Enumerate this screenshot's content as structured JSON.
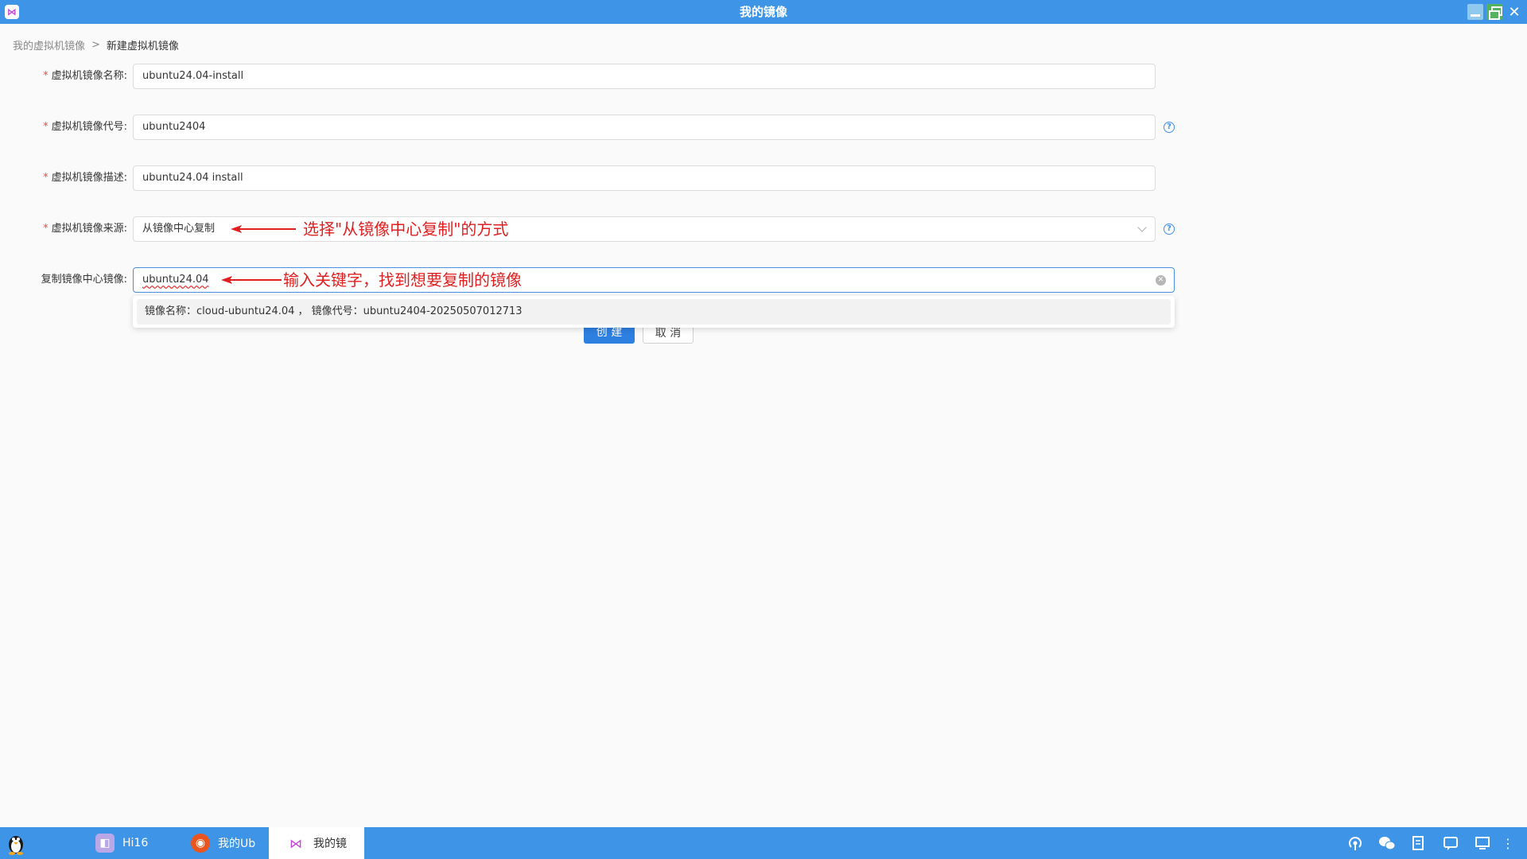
{
  "window": {
    "title": "我的镜像",
    "app_icon_glyph": "⋈",
    "min_label": "",
    "max_label": "",
    "close_label": "✕"
  },
  "breadcrumb": {
    "parent": "我的虚拟机镜像",
    "separator": ">",
    "current": "新建虚拟机镜像"
  },
  "form": {
    "name_label": "虚拟机镜像名称:",
    "name_value": "ubuntu24.04-install",
    "code_label": "虚拟机镜像代号:",
    "code_value": "ubuntu2404",
    "desc_label": "虚拟机镜像描述:",
    "desc_value": "ubuntu24.04 install",
    "source_label": "虚拟机镜像来源:",
    "source_value": "从镜像中心复制",
    "copy_label": "复制镜像中心镜像:",
    "copy_value": "ubuntu24.04",
    "required_mark": "*",
    "help_glyph": "?"
  },
  "annotations": {
    "source_note": "选择\"从镜像中心复制\"的方式",
    "copy_note": "输入关键字，找到想要复制的镜像"
  },
  "dropdown": {
    "item": "镜像名称：cloud-ubuntu24.04 ，  镜像代号：ubuntu2404-20250507012713"
  },
  "buttons": {
    "create": "创 建",
    "cancel": "取 消"
  },
  "taskbar": {
    "items": [
      {
        "label": "Hi16"
      },
      {
        "label": "我的Ub"
      },
      {
        "label": "我的镜"
      }
    ]
  },
  "colors": {
    "titlebar": "#3e95e8",
    "primary": "#2d7fe0",
    "annotation": "#e02020"
  }
}
